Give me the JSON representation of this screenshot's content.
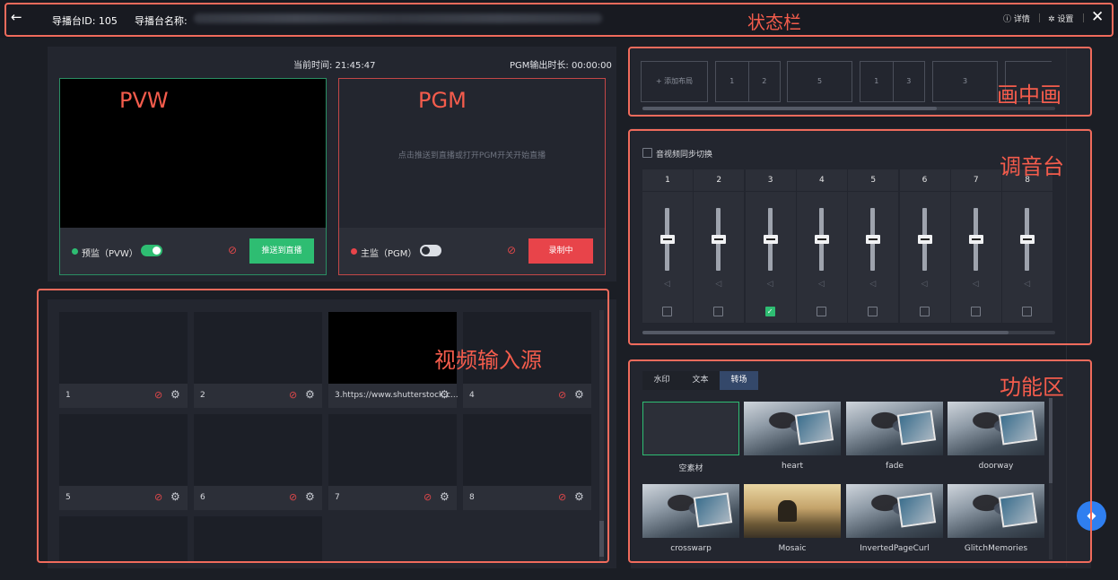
{
  "topbar": {
    "back_icon": "←",
    "id_label": "导播台ID: 105",
    "name_label": "导播台名称:",
    "detail_label": "ⓘ 详情",
    "settings_label": "✲ 设置",
    "close_icon": "✕"
  },
  "annotations": {
    "status_bar": "状态栏",
    "pvw": "PVW",
    "pgm": "PGM",
    "pip": "画中画",
    "mixer": "调音台",
    "inputs": "视频输入源",
    "functions": "功能区"
  },
  "monitor": {
    "current_time": "当前时间: 21:45:47",
    "pgm_duration": "PGM输出时长: 00:00:00",
    "pvw_name": "预监（PVW）",
    "pgm_name": "主监（PGM）",
    "pgm_hint": "点击推送到直播或打开PGM开关开始直播",
    "push_button": "推送到直播",
    "record_button": "录制中",
    "pvw_toggle_on": true,
    "pgm_toggle_on": false
  },
  "inputs": [
    {
      "label": "1",
      "has_image": false
    },
    {
      "label": "2",
      "has_image": false
    },
    {
      "label": "3.https://www.shutterstock.c...",
      "has_image": true
    },
    {
      "label": "4",
      "has_image": false
    },
    {
      "label": "5",
      "has_image": false
    },
    {
      "label": "6",
      "has_image": false
    },
    {
      "label": "7",
      "has_image": false
    },
    {
      "label": "8",
      "has_image": false
    }
  ],
  "pip": {
    "add_layout": "+ 添加布局",
    "layouts": [
      {
        "cells": [
          "1",
          "2"
        ]
      },
      {
        "cells": [
          "5"
        ]
      },
      {
        "cells": [
          "1",
          "3"
        ]
      },
      {
        "cells": [
          "3"
        ]
      }
    ]
  },
  "mixer": {
    "sync_label": "音视频同步切换",
    "channels": [
      {
        "label": "1",
        "checked": false
      },
      {
        "label": "2",
        "checked": false
      },
      {
        "label": "3",
        "checked": true
      },
      {
        "label": "4",
        "checked": false
      },
      {
        "label": "5",
        "checked": false
      },
      {
        "label": "6",
        "checked": false
      },
      {
        "label": "7",
        "checked": false
      },
      {
        "label": "8",
        "checked": false
      }
    ]
  },
  "functions": {
    "tabs": [
      {
        "label": "水印",
        "active": false
      },
      {
        "label": "文本",
        "active": false
      },
      {
        "label": "转场",
        "active": true
      }
    ],
    "transitions": [
      "空素材",
      "heart",
      "fade",
      "doorway",
      "crosswarp",
      "Mosaic",
      "InvertedPageCurl",
      "GlitchMemories"
    ]
  },
  "icons": {
    "mute": "⊘",
    "gear": "⚙",
    "speaker": "◁",
    "float": "◆"
  },
  "colors": {
    "accent_green": "#2ebd72",
    "accent_red": "#e8444a",
    "annotation": "#f06b5c",
    "active_tab": "#34486a"
  }
}
